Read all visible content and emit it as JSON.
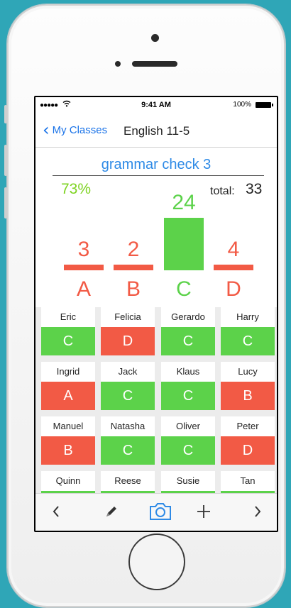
{
  "status_bar": {
    "time": "9:41 AM",
    "battery": "100%"
  },
  "nav": {
    "back_label": "My Classes",
    "title": "English 11-5"
  },
  "quiz": {
    "title": "grammar check 3",
    "percent": "73%",
    "total_label": "total:",
    "total_value": "33",
    "correct_answer": "C"
  },
  "colors": {
    "correct": "#5cd24a",
    "wrong": "#f25a45",
    "accent": "#2e8ae6",
    "percent": "#7ed321"
  },
  "answer_distribution": [
    {
      "letter": "A",
      "count": "3"
    },
    {
      "letter": "B",
      "count": "2"
    },
    {
      "letter": "C",
      "count": "24"
    },
    {
      "letter": "D",
      "count": "4"
    }
  ],
  "students": [
    {
      "name": "Eric",
      "answer": "C"
    },
    {
      "name": "Felicia",
      "answer": "D"
    },
    {
      "name": "Gerardo",
      "answer": "C"
    },
    {
      "name": "Harry",
      "answer": "C"
    },
    {
      "name": "Ingrid",
      "answer": "A"
    },
    {
      "name": "Jack",
      "answer": "C"
    },
    {
      "name": "Klaus",
      "answer": "C"
    },
    {
      "name": "Lucy",
      "answer": "B"
    },
    {
      "name": "Manuel",
      "answer": "B"
    },
    {
      "name": "Natasha",
      "answer": "C"
    },
    {
      "name": "Oliver",
      "answer": "C"
    },
    {
      "name": "Peter",
      "answer": "D"
    },
    {
      "name": "Quinn",
      "answer": ""
    },
    {
      "name": "Reese",
      "answer": ""
    },
    {
      "name": "Susie",
      "answer": ""
    },
    {
      "name": "Tan",
      "answer": ""
    }
  ],
  "toolbar": [
    "chevron-left-icon",
    "pencil-icon",
    "camera-icon",
    "plus-icon",
    "chevron-right-icon"
  ]
}
